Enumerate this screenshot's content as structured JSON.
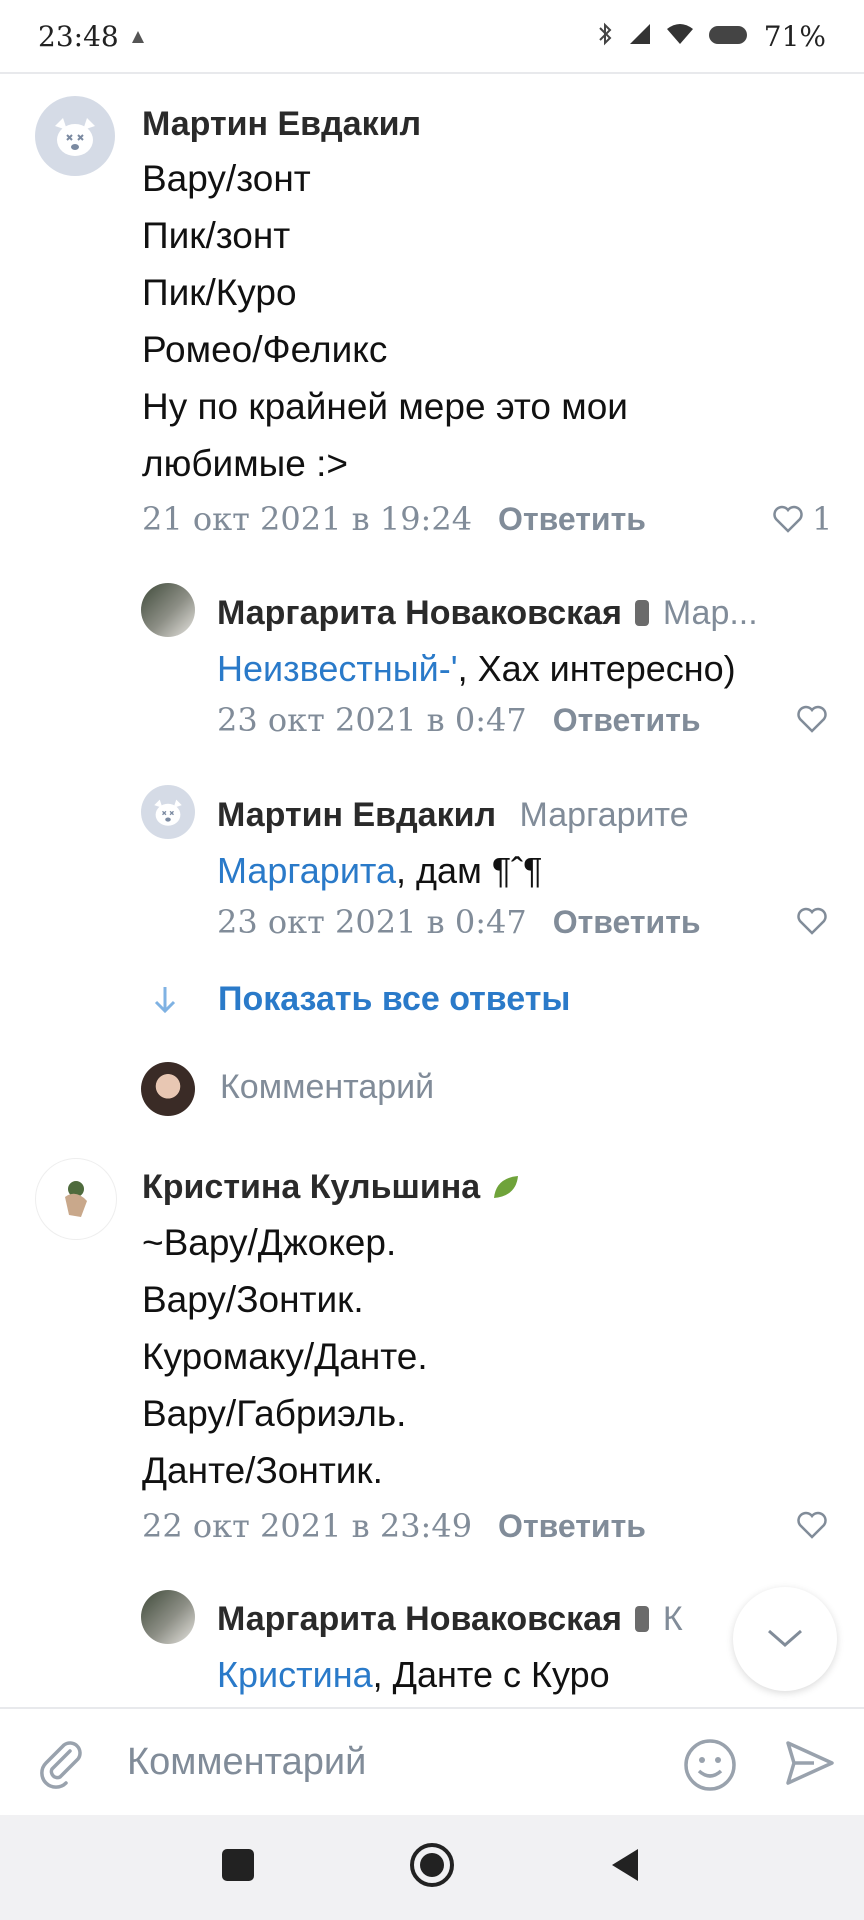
{
  "status": {
    "time": "23:48",
    "battery": "71%"
  },
  "comments": [
    {
      "author": "Мартин Евдакил",
      "lines": [
        "Вару/зонт",
        "Пик/зонт",
        "Пик/Куро",
        "Ромео/Феликс",
        "Ну по крайней мере это мои",
        "любимые :>"
      ],
      "date": "21 окт 2021 в 19:24",
      "reply_label": "Ответить",
      "likes": "1"
    },
    {
      "author": "Кристина Кульшина",
      "lines": [
        "~Вару/Джокер.",
        "Вару/Зонтик.",
        "Куромаку/Данте.",
        "Вару/Габриэль.",
        "Данте/Зонтик."
      ],
      "date": "22 окт 2021 в 23:49",
      "reply_label": "Ответить"
    }
  ],
  "replies": [
    {
      "author": "Маргарита Новаковская",
      "meta": "Мар...",
      "mention": "Неизвестный-'",
      "text": ", Хах интересно)",
      "date": "23 окт 2021 в 0:47",
      "reply_label": "Ответить"
    },
    {
      "author": "Мартин Евдакил",
      "meta": "Маргарите",
      "mention": "Маргарита",
      "text": ", дам ¶ˆ¶",
      "date": "23 окт 2021 в 0:47",
      "reply_label": "Ответить"
    },
    {
      "author": "Маргарита Новаковская",
      "meta": "К",
      "mention": "Кристина",
      "text": ", Данте с Куро"
    }
  ],
  "show_all_replies": "Показать все ответы",
  "comment_prompt": "Комментарий",
  "composer": {
    "placeholder": "Комментарий"
  },
  "colors": {
    "accent": "#2a7ac9",
    "muted": "#818c99",
    "divider": "#e8e9ec"
  }
}
